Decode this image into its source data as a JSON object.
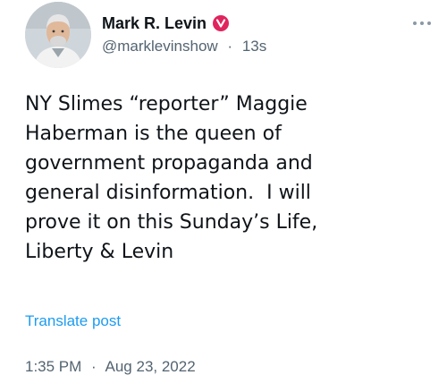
{
  "author": {
    "display_name": "Mark R. Levin",
    "handle": "@marklevinshow",
    "separator": "·",
    "relative_time": "13s",
    "avatar_icon": "user-avatar-photo",
    "verified_icon": "verified-badge-icon",
    "verified_color": "#e0245e"
  },
  "post": {
    "text": "NY Slimes “reporter” Maggie\nHaberman is the queen of\ngovernment propaganda and\ngeneral disinformation.  I will\nprove it on this Sunday’s Life,\nLiberty & Levin",
    "translate_label": "Translate post",
    "time": "1:35 PM",
    "separator": "·",
    "date": "Aug 23, 2022"
  },
  "menu": {
    "more_icon": "more-options-icon"
  },
  "colors": {
    "text_primary": "#0f1419",
    "text_secondary": "#536471",
    "link": "#1d9bf0"
  }
}
